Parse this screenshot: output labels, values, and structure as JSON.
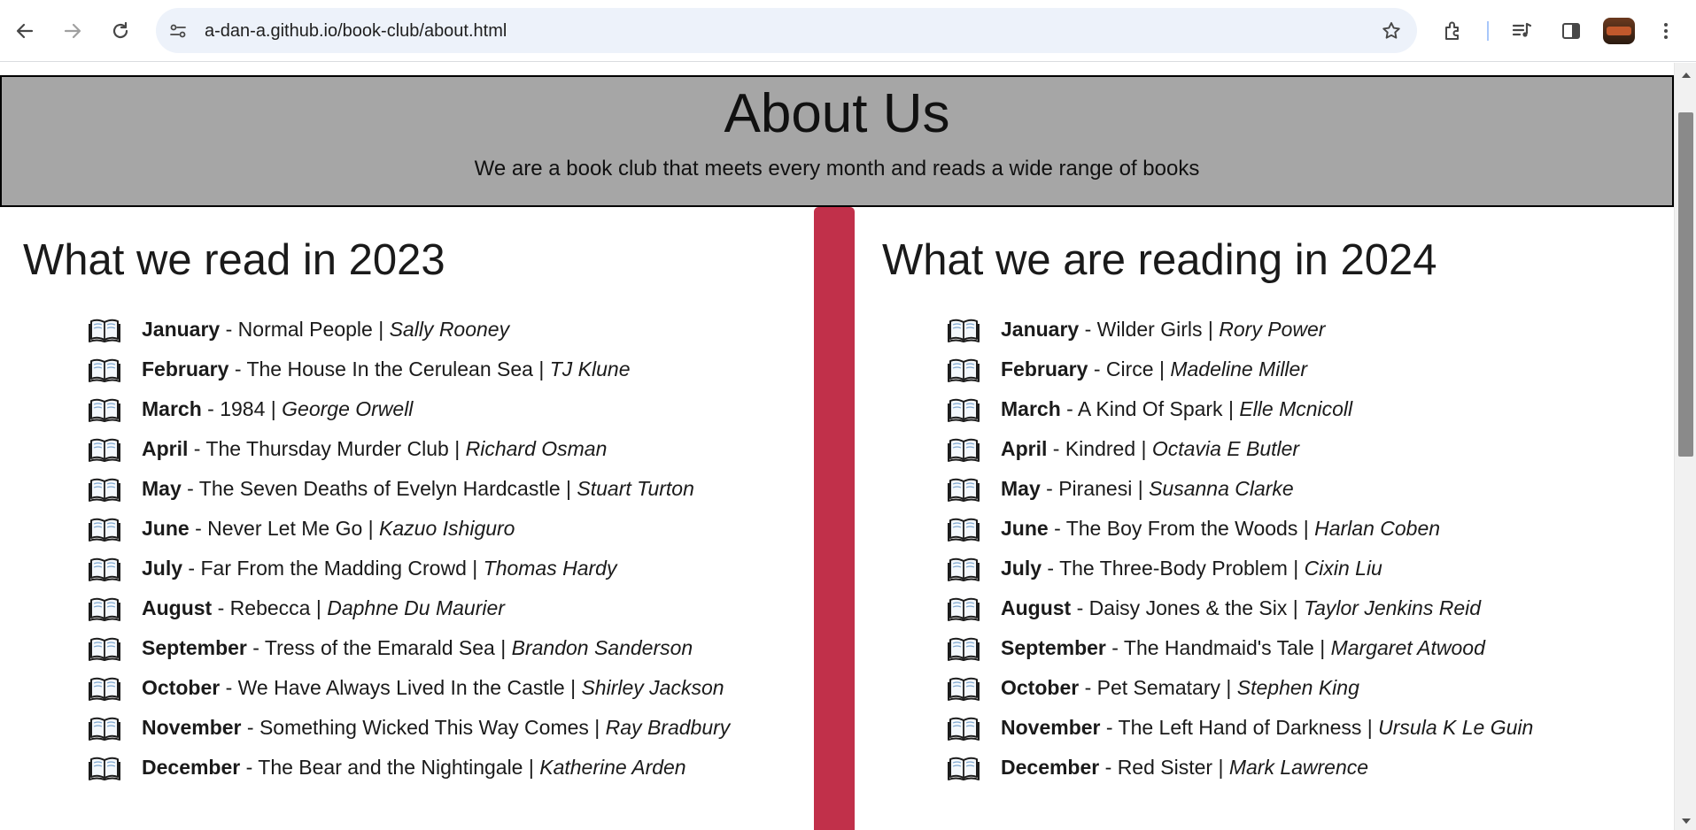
{
  "browser": {
    "url": "a-dan-a.github.io/book-club/about.html",
    "icons": [
      "back-arrow-icon",
      "forward-arrow-icon",
      "reload-icon",
      "site-info-icon",
      "bookmark-star-icon",
      "extensions-icon",
      "media-controls-icon",
      "side-panel-icon",
      "profile-avatar",
      "more-menu-icon"
    ]
  },
  "header": {
    "title": "About Us",
    "subtitle": "We are a book club that meets every month and reads a wide range of books"
  },
  "colors": {
    "header_bg": "#a6a6a6",
    "divider": "#c1304a"
  },
  "left": {
    "heading": "What we read in 2023",
    "books": [
      {
        "month": "January",
        "title": "Normal People",
        "author": "Sally Rooney"
      },
      {
        "month": "February",
        "title": "The House In the Cerulean Sea",
        "author": "TJ Klune"
      },
      {
        "month": "March",
        "title": "1984",
        "author": "George Orwell"
      },
      {
        "month": "April",
        "title": "The Thursday Murder Club",
        "author": "Richard Osman"
      },
      {
        "month": "May",
        "title": "The Seven Deaths of Evelyn Hardcastle",
        "author": "Stuart Turton"
      },
      {
        "month": "June",
        "title": "Never Let Me Go",
        "author": "Kazuo Ishiguro"
      },
      {
        "month": "July",
        "title": "Far From the Madding Crowd",
        "author": "Thomas Hardy"
      },
      {
        "month": "August",
        "title": "Rebecca",
        "author": "Daphne Du Maurier"
      },
      {
        "month": "September",
        "title": "Tress of the Emarald Sea",
        "author": "Brandon Sanderson"
      },
      {
        "month": "October",
        "title": "We Have Always Lived In the Castle",
        "author": "Shirley Jackson"
      },
      {
        "month": "November",
        "title": "Something Wicked This Way Comes",
        "author": "Ray Bradbury"
      },
      {
        "month": "December",
        "title": "The Bear and the Nightingale",
        "author": "Katherine Arden"
      }
    ]
  },
  "right": {
    "heading": "What we are reading in 2024",
    "books": [
      {
        "month": "January",
        "title": "Wilder Girls",
        "author": "Rory Power"
      },
      {
        "month": "February",
        "title": "Circe",
        "author": "Madeline Miller"
      },
      {
        "month": "March",
        "title": "A Kind Of Spark",
        "author": "Elle Mcnicoll"
      },
      {
        "month": "April",
        "title": "Kindred",
        "author": "Octavia E Butler"
      },
      {
        "month": "May",
        "title": "Piranesi",
        "author": "Susanna Clarke"
      },
      {
        "month": "June",
        "title": "The Boy From the Woods",
        "author": "Harlan Coben"
      },
      {
        "month": "July",
        "title": "The Three-Body Problem",
        "author": "Cixin Liu"
      },
      {
        "month": "August",
        "title": "Daisy Jones & the Six",
        "author": "Taylor Jenkins Reid"
      },
      {
        "month": "September",
        "title": "The Handmaid's Tale",
        "author": "Margaret Atwood"
      },
      {
        "month": "October",
        "title": "Pet Sematary",
        "author": "Stephen King"
      },
      {
        "month": "November",
        "title": "The Left Hand of Darkness",
        "author": "Ursula K Le Guin"
      },
      {
        "month": "December",
        "title": "Red Sister",
        "author": "Mark Lawrence"
      }
    ]
  }
}
